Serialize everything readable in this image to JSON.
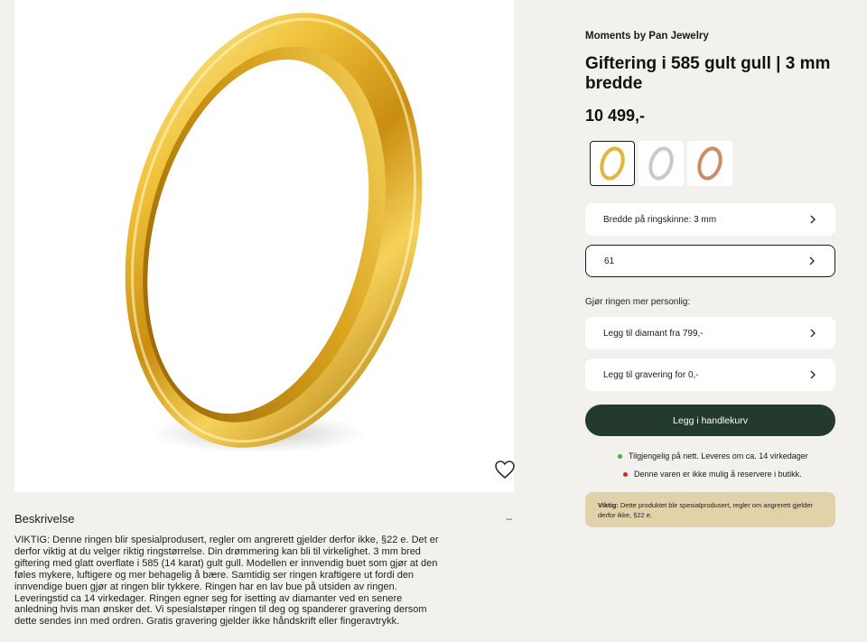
{
  "product": {
    "brand": "Moments by Pan Jewelry",
    "title": "Giftering i 585 gult gull | 3 mm bredde",
    "price": "10 499,-"
  },
  "image": {
    "alt": "gold-ring"
  },
  "swatches": [
    {
      "name": "gold",
      "color": "#e3b53a",
      "selected": true
    },
    {
      "name": "silver",
      "color": "#c9c9c9",
      "selected": false
    },
    {
      "name": "rose-gold",
      "color": "#d08a6a",
      "selected": false
    }
  ],
  "options": {
    "width_label": "Bredde på ringskinne: 3 mm",
    "size_value": "61",
    "personal_label": "Gjør ringen mer personlig:",
    "diamond_label": "Legg til diamant fra 799,-",
    "engraving_label": "Legg til gravering for 0,-"
  },
  "cart": {
    "button_label": "Legg i handlekurv"
  },
  "availability": {
    "online": "Tilgjengelig på nett. Leveres om ca. 14 virkedager",
    "online_color": "#3db14a",
    "store": "Denne varen er ikke mulig å reservere i butikk.",
    "store_color": "#d22a1e"
  },
  "notice": {
    "bold": "Viktig:",
    "text": " Dette produktet blir spesialprodusert, regler om angrerett gjelder derfor ikke, §22 e."
  },
  "description": {
    "title": "Beskrivelse",
    "toggle": "–",
    "text": "VIKTIG: Denne ringen blir spesialprodusert, regler om angrerett gjelder derfor ikke, §22 e. Det er derfor viktig at du velger riktig ringstørrelse. Din drømmering kan bli til virkelighet. 3 mm bred giftering med glatt overflate i 585 (14 karat) gult gull. Modellen er innvendig buet som gjør at den føles mykere, luftigere og mer behagelig å bære. Samtidig ser ringen kraftigere ut fordi den innvendige buen gjør at ringen blir tykkere. Ringen har en lav bue på utsiden av ringen. Leveringstid ca 14 virkedager. Ringen egner seg for isetting av diamanter ved en senere anledning hvis man ønsker det. Vi spesialstøper ringen til deg og spanderer gravering dersom dette sendes inn med ordren. Gratis gravering gjelder ikke håndskrift eller fingeravtrykk."
  }
}
